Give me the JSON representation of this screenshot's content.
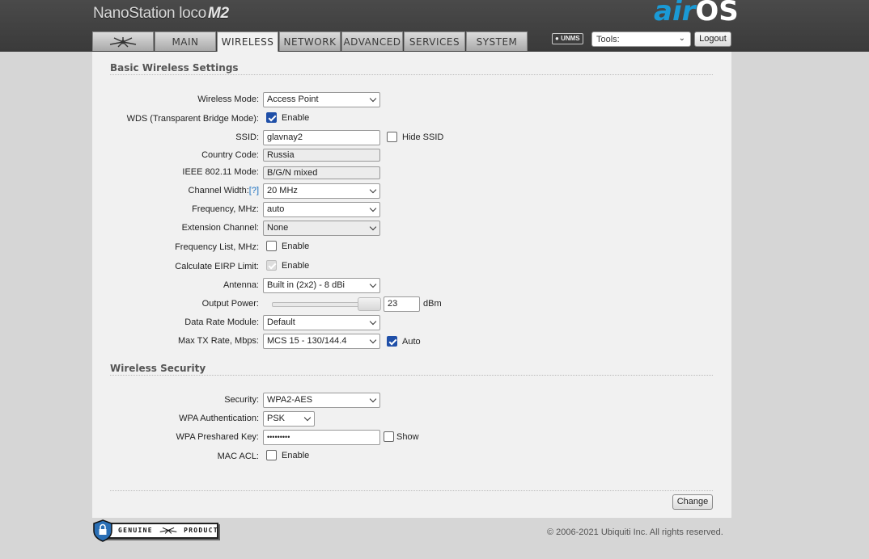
{
  "header": {
    "brand_name": "NanoStation loco",
    "brand_model": "M2",
    "os_air": "air",
    "os_os": "OS"
  },
  "tabs": [
    {
      "label": "",
      "icon": "ubiquiti-logo-icon"
    },
    {
      "label": "MAIN"
    },
    {
      "label": "WIRELESS",
      "active": true
    },
    {
      "label": "NETWORK"
    },
    {
      "label": "ADVANCED"
    },
    {
      "label": "SERVICES"
    },
    {
      "label": "SYSTEM"
    }
  ],
  "toolbar": {
    "unms_label": "UNMS",
    "tools_value": "Tools:",
    "logout_label": "Logout"
  },
  "basic": {
    "title": "Basic Wireless Settings",
    "wireless_mode": {
      "label": "Wireless Mode:",
      "value": "Access Point"
    },
    "wds": {
      "label": "WDS (Transparent Bridge Mode):",
      "option": "Enable",
      "checked": true
    },
    "ssid": {
      "label": "SSID:",
      "value": "glavnay2",
      "hide_label": "Hide SSID",
      "hide_checked": false
    },
    "country": {
      "label": "Country Code:",
      "value": "Russia"
    },
    "ieee": {
      "label": "IEEE 802.11 Mode:",
      "value": "B/G/N mixed"
    },
    "channel_width": {
      "label": "Channel Width:",
      "help": "[?]",
      "value": "20 MHz"
    },
    "frequency": {
      "label": "Frequency, MHz:",
      "value": "auto"
    },
    "ext_channel": {
      "label": "Extension Channel:",
      "value": "None"
    },
    "freq_list": {
      "label": "Frequency List, MHz:",
      "option": "Enable",
      "checked": false
    },
    "eirp": {
      "label": "Calculate EIRP Limit:",
      "option": "Enable",
      "checked": true
    },
    "antenna": {
      "label": "Antenna:",
      "value": "Built in (2x2) - 8 dBi"
    },
    "output_power": {
      "label": "Output Power:",
      "value": "23",
      "unit": "dBm",
      "slider_fraction": 1.0
    },
    "data_rate": {
      "label": "Data Rate Module:",
      "value": "Default"
    },
    "max_tx": {
      "label": "Max TX Rate, Mbps:",
      "value": "MCS 15 - 130/144.4",
      "auto_label": "Auto",
      "auto_checked": true
    }
  },
  "security": {
    "title": "Wireless Security",
    "security": {
      "label": "Security:",
      "value": "WPA2-AES"
    },
    "wpa_auth": {
      "label": "WPA Authentication:",
      "value": "PSK"
    },
    "psk": {
      "label": "WPA Preshared Key:",
      "value": "•••••••••",
      "show_label": "Show",
      "show_checked": false
    },
    "mac_acl": {
      "label": "MAC ACL:",
      "option": "Enable",
      "checked": false
    }
  },
  "actions": {
    "change_label": "Change"
  },
  "footer": {
    "genuine_label": "GENUINE",
    "product_label": "PRODUCT",
    "copyright": "© 2006-2021 Ubiquiti Inc. All rights reserved."
  }
}
